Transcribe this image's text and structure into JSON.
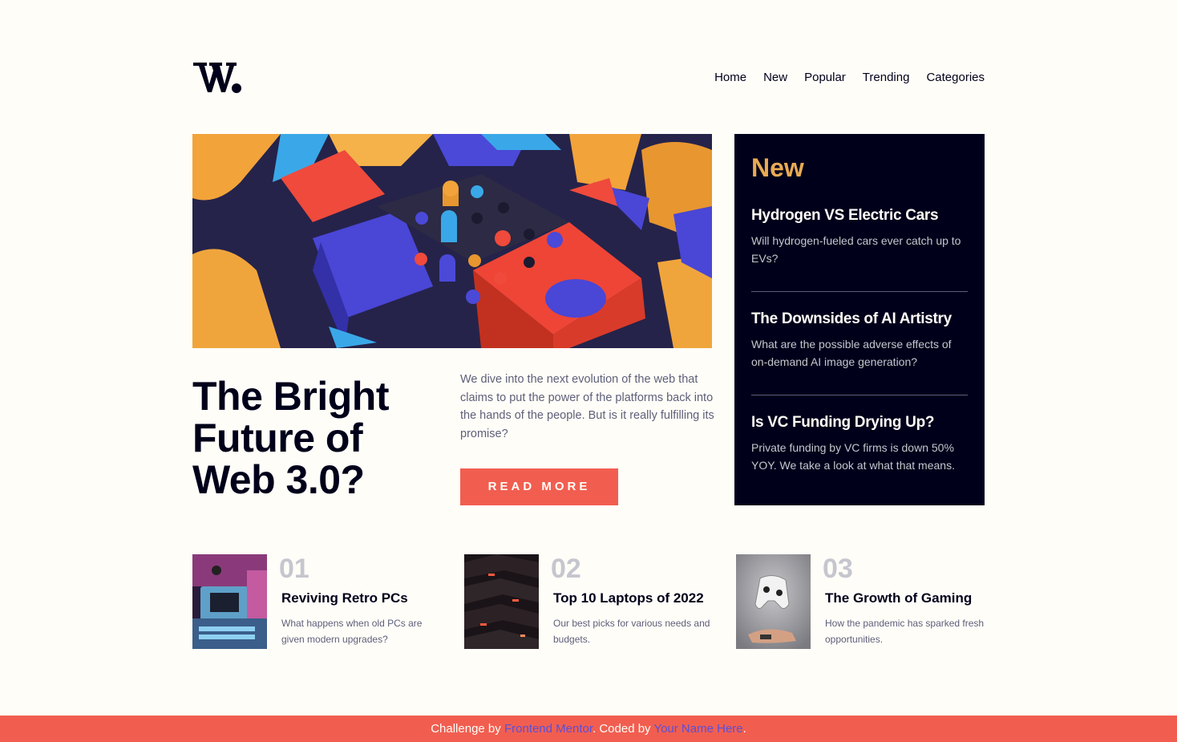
{
  "brand": {
    "logo_text": "W."
  },
  "nav": {
    "items": [
      {
        "label": "Home"
      },
      {
        "label": "New"
      },
      {
        "label": "Popular"
      },
      {
        "label": "Trending"
      },
      {
        "label": "Categories"
      }
    ]
  },
  "hero": {
    "title": "The Bright Future of Web 3.0?",
    "description": "We dive into the next evolution of the web that claims to put the power of the platforms back into the hands of the people. But is it really fulfilling its promise?",
    "button_label": "READ MORE"
  },
  "new_panel": {
    "heading": "New",
    "items": [
      {
        "title": "Hydrogen VS Electric Cars",
        "description": "Will hydrogen-fueled cars ever catch up to EVs?"
      },
      {
        "title": "The Downsides of AI Artistry",
        "description": "What are the possible adverse effects of on-demand AI image generation?"
      },
      {
        "title": "Is VC Funding Drying Up?",
        "description": "Private funding by VC firms is down 50% YOY. We take a look at what that means."
      }
    ]
  },
  "articles": [
    {
      "number": "01",
      "title": "Reviving Retro PCs",
      "description": "What happens when old PCs are given modern upgrades?"
    },
    {
      "number": "02",
      "title": "Top 10 Laptops of 2022",
      "description": "Our best picks for various needs and budgets."
    },
    {
      "number": "03",
      "title": "The Growth of Gaming",
      "description": "How the pandemic has sparked fresh opportunities."
    }
  ],
  "footer": {
    "prefix": "Challenge by ",
    "link1": "Frontend Mentor",
    "middle": ". Coded by ",
    "link2": "Your Name Here",
    "suffix": "."
  },
  "colors": {
    "background": "#fffdf8",
    "accent_red": "#f15e50",
    "accent_orange": "#e9ab53",
    "dark_navy": "#00001a",
    "grayish_blue": "#5d5f79",
    "link_blue": "#5b4fd6"
  }
}
